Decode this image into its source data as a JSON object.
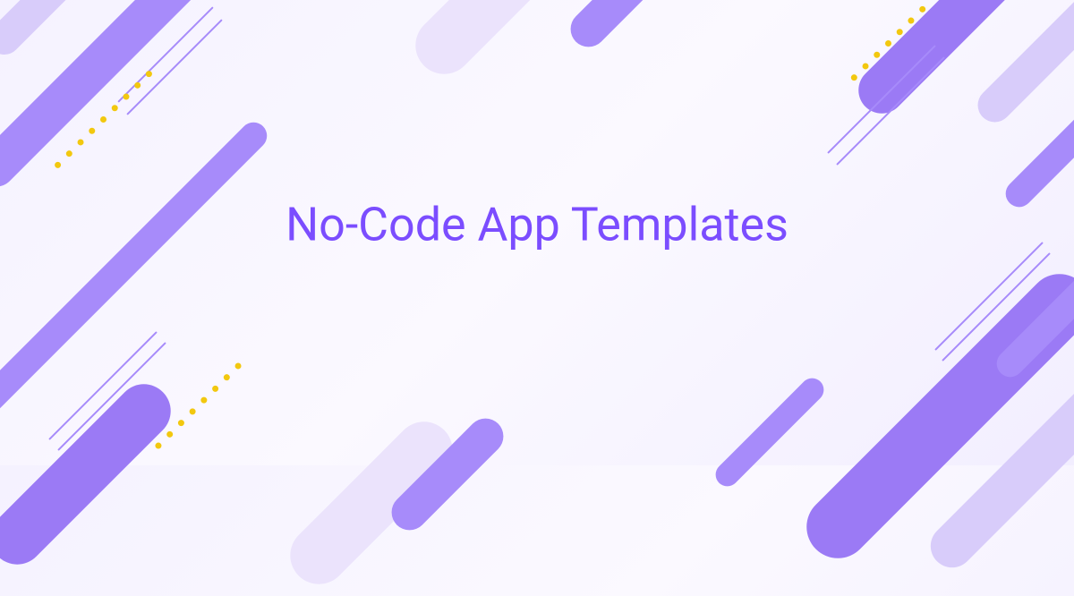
{
  "title": "No-Code App Templates",
  "colors": {
    "accent": "#7b4dff",
    "mid": "#a78bfa",
    "light": "#d8ccfa",
    "faint": "#ebe3fc",
    "dot": "#f2c80f"
  }
}
